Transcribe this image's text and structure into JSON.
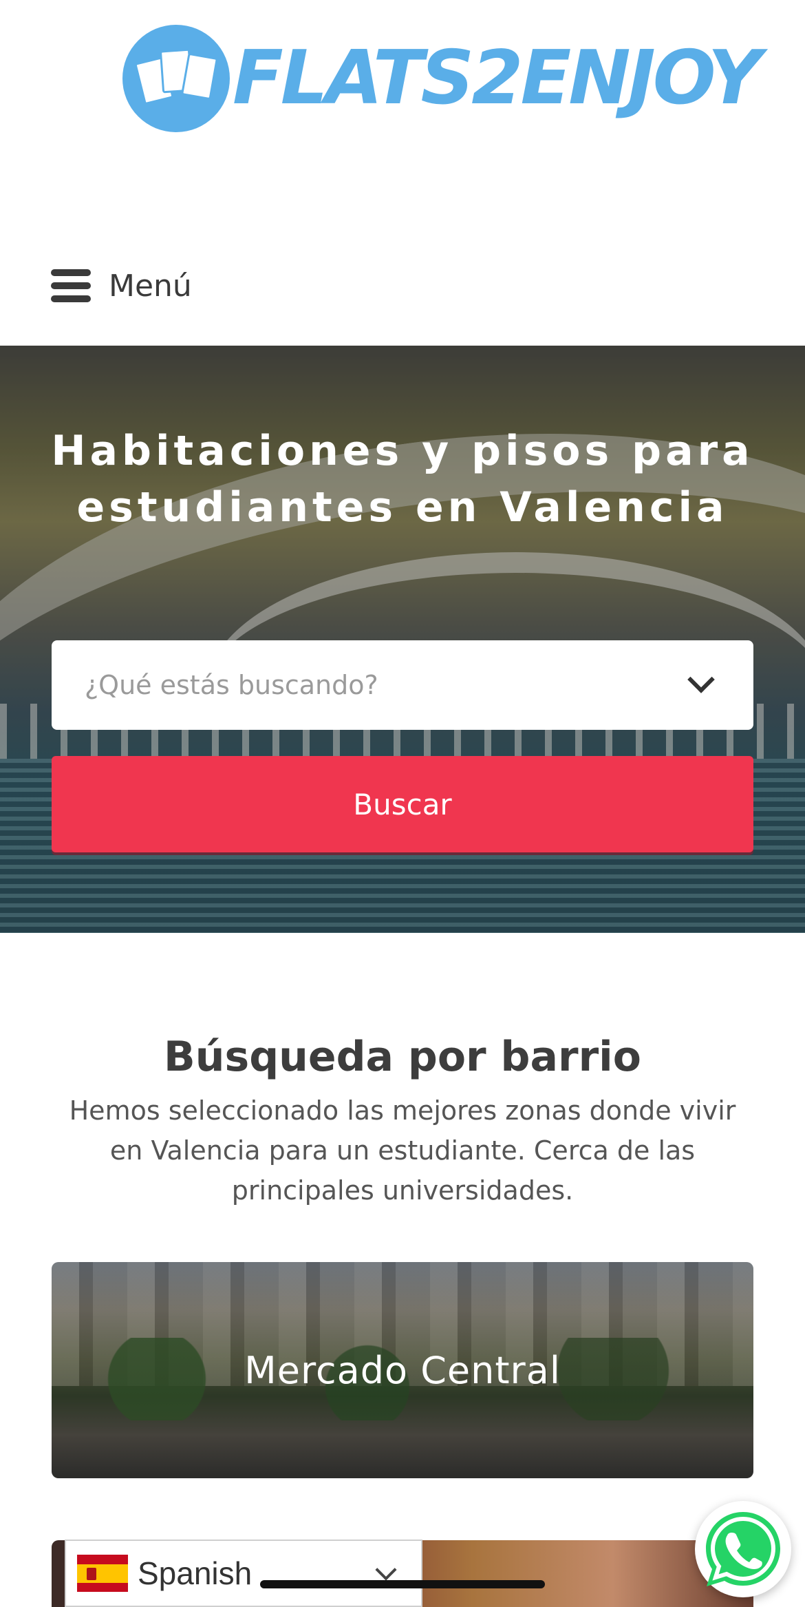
{
  "header": {
    "logo_text": "FLATS2ENJOY",
    "menu_label": "Menú",
    "brand_color": "#5aaee8"
  },
  "hero": {
    "title": "Habitaciones y pisos para estudiantes en Valencia",
    "search_placeholder": "¿Qué estás buscando?",
    "search_button_label": "Buscar",
    "button_color": "#f0364f"
  },
  "neighborhoods": {
    "title": "Búsqueda por barrio",
    "description": "Hemos seleccionado las mejores zonas donde vivir en Valencia para un estudiante. Cerca de las principales universidades.",
    "cards": [
      {
        "label": "Mercado Central"
      }
    ]
  },
  "language_selector": {
    "selected": "Spanish",
    "flag": "spain-flag-icon"
  },
  "floating": {
    "whatsapp_icon": "whatsapp-icon",
    "whatsapp_color": "#25d366"
  }
}
